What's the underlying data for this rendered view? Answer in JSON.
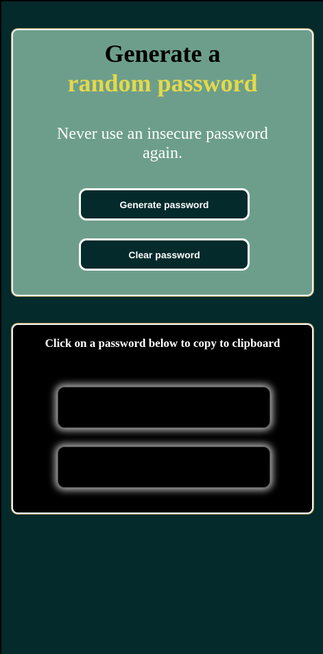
{
  "hero": {
    "title_line1": "Generate a",
    "title_line2": "random password",
    "subtitle": "Never use an insecure password again.",
    "generate_label": "Generate password",
    "clear_label": "Clear password",
    "accent_color": "#e4d94a",
    "card_color": "#6d9e8c"
  },
  "results": {
    "instructions": "Click on a password below to copy to clipboard",
    "passwords": [
      "",
      ""
    ]
  },
  "colors": {
    "background": "#052a2b",
    "button_bg": "#052a2b",
    "results_bg": "#000000"
  }
}
